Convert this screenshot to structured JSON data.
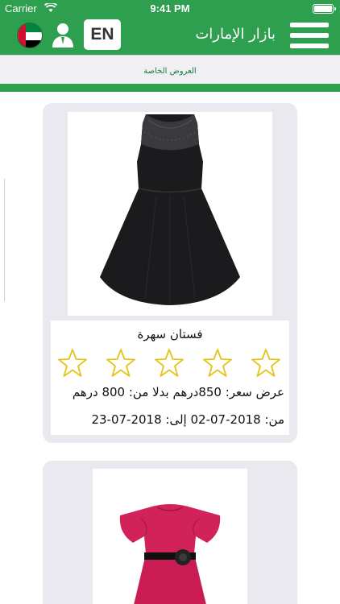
{
  "status_bar": {
    "carrier": "Carrier",
    "time": "9:41 PM"
  },
  "header": {
    "app_title": "بازار الإمارات",
    "language_button": "EN",
    "icons": {
      "flag": "uae-flag-icon",
      "user": "user-icon",
      "menu": "hamburger-menu-icon"
    }
  },
  "page": {
    "section_title": "العروض الخاصة"
  },
  "products": [
    {
      "name": "فستان سهرة",
      "rating_max": 5,
      "rating_filled": 0,
      "price_text": "عرض سعر: 850درهم بدلا من: 800 درهم",
      "date_text": "من: 2018-07-02 إلى: 2018-07-23",
      "dress_color": "#1b1b1d"
    },
    {
      "dress_color": "#d2225a"
    }
  ],
  "colors": {
    "brand_green": "#2e9e4f",
    "card_bg": "#e9e9ef",
    "star_outline": "#e3c51a"
  }
}
